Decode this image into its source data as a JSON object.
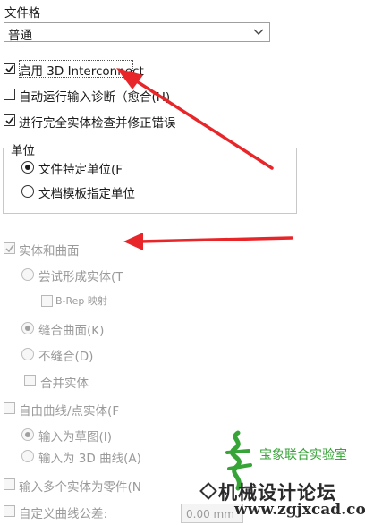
{
  "file_format": {
    "label": "文件格",
    "value": "普通"
  },
  "options": {
    "enable_3d": "启用 3D Interconnect",
    "auto_diag": "自动运行输入诊断（愈合(H)",
    "full_check": "进行完全实体检查并修正错误"
  },
  "units": {
    "title": "单位",
    "file_specific": "文件特定单位(F",
    "doc_template": "文档模板指定单位"
  },
  "solids_surfaces": {
    "label": "实体和曲面",
    "try_form": "尝试形成实体(T",
    "brep_map": "B-Rep 映射",
    "knit": "缝合曲面(K)",
    "no_knit": "不缝合(D)",
    "merge": "合并实体"
  },
  "free_curves": {
    "label": "自由曲线/点实体(F",
    "as_sketch": "输入为草图(I)",
    "as_3d_curve": "输入为 3D 曲线(A)"
  },
  "multi_body": {
    "label": "输入多个实体为零件(N"
  },
  "custom_tol": {
    "label": "自定义曲线公差:",
    "value": "0.00 mm"
  },
  "watermark": {
    "lab": "宝象联合实验室",
    "forum": "机械设计论坛",
    "url": "www.zgjxcad.com"
  },
  "colors": {
    "arrow": "#e8262a",
    "disabled": "#9a9a9a",
    "watermark_green": "#37a437"
  }
}
